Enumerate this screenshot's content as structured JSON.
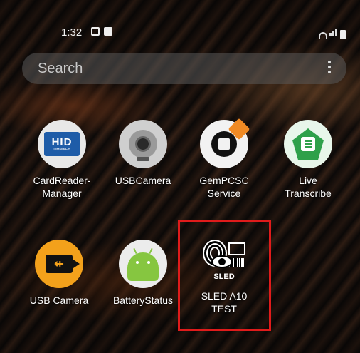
{
  "status_bar": {
    "time": "1:32"
  },
  "search": {
    "placeholder": "Search"
  },
  "apps": [
    {
      "label": "CardReader-\nManager",
      "icon": "hid-omnikey-icon",
      "icon_text": "HID",
      "icon_subtext": "OMNIKEY"
    },
    {
      "label": "USBCamera",
      "icon": "webcam-icon"
    },
    {
      "label": "GemPCSC\nService",
      "icon": "gemalto-icon"
    },
    {
      "label": "Live\nTranscribe",
      "icon": "live-transcribe-icon"
    },
    {
      "label": "USB Camera",
      "icon": "usb-video-camera-icon"
    },
    {
      "label": "BatteryStatus",
      "icon": "android-icon"
    },
    {
      "label": "SLED A10\nTEST",
      "icon": "sled-biometric-icon",
      "icon_text": "SLED"
    }
  ],
  "colors": {
    "highlight_border": "#e01b1b",
    "hid_blue": "#1e5ca8",
    "usb_orange": "#f3a11b",
    "android_green": "#86c640",
    "transcribe_green": "#2ea04a"
  }
}
